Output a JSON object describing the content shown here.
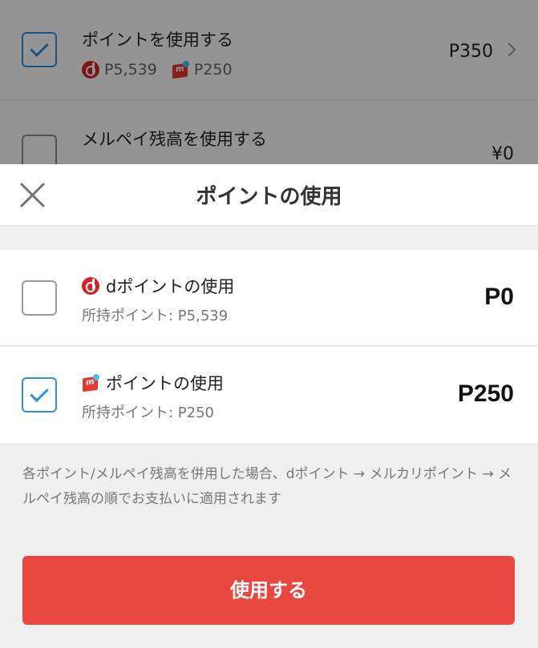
{
  "background": {
    "row1": {
      "title": "ポイントを使用する",
      "dpoints": "P5,539",
      "mpoints": "P250",
      "amount": "P350",
      "checked": true
    },
    "row2": {
      "title": "メルペイ残高を使用する",
      "amount": "¥0",
      "checked": false
    }
  },
  "modal": {
    "title": "ポイントの使用",
    "options": [
      {
        "name": "dポイントの使用",
        "held": "所持ポイント: P5,539",
        "amount": "P0",
        "checked": false,
        "icon": "d-point-icon"
      },
      {
        "name": "ポイントの使用",
        "held": "所持ポイント: P250",
        "amount": "P250",
        "checked": true,
        "icon": "mercari-point-icon"
      }
    ],
    "note": "各ポイント/メルペイ残高を併用した場合、dポイント → メルカリポイント → メルペイ残高の順でお支払いに適用されます",
    "button_label": "使用する"
  },
  "colors": {
    "accent_blue": "#2f8fd8",
    "button_red": "#e8483f",
    "d_red": "#d2232a"
  }
}
